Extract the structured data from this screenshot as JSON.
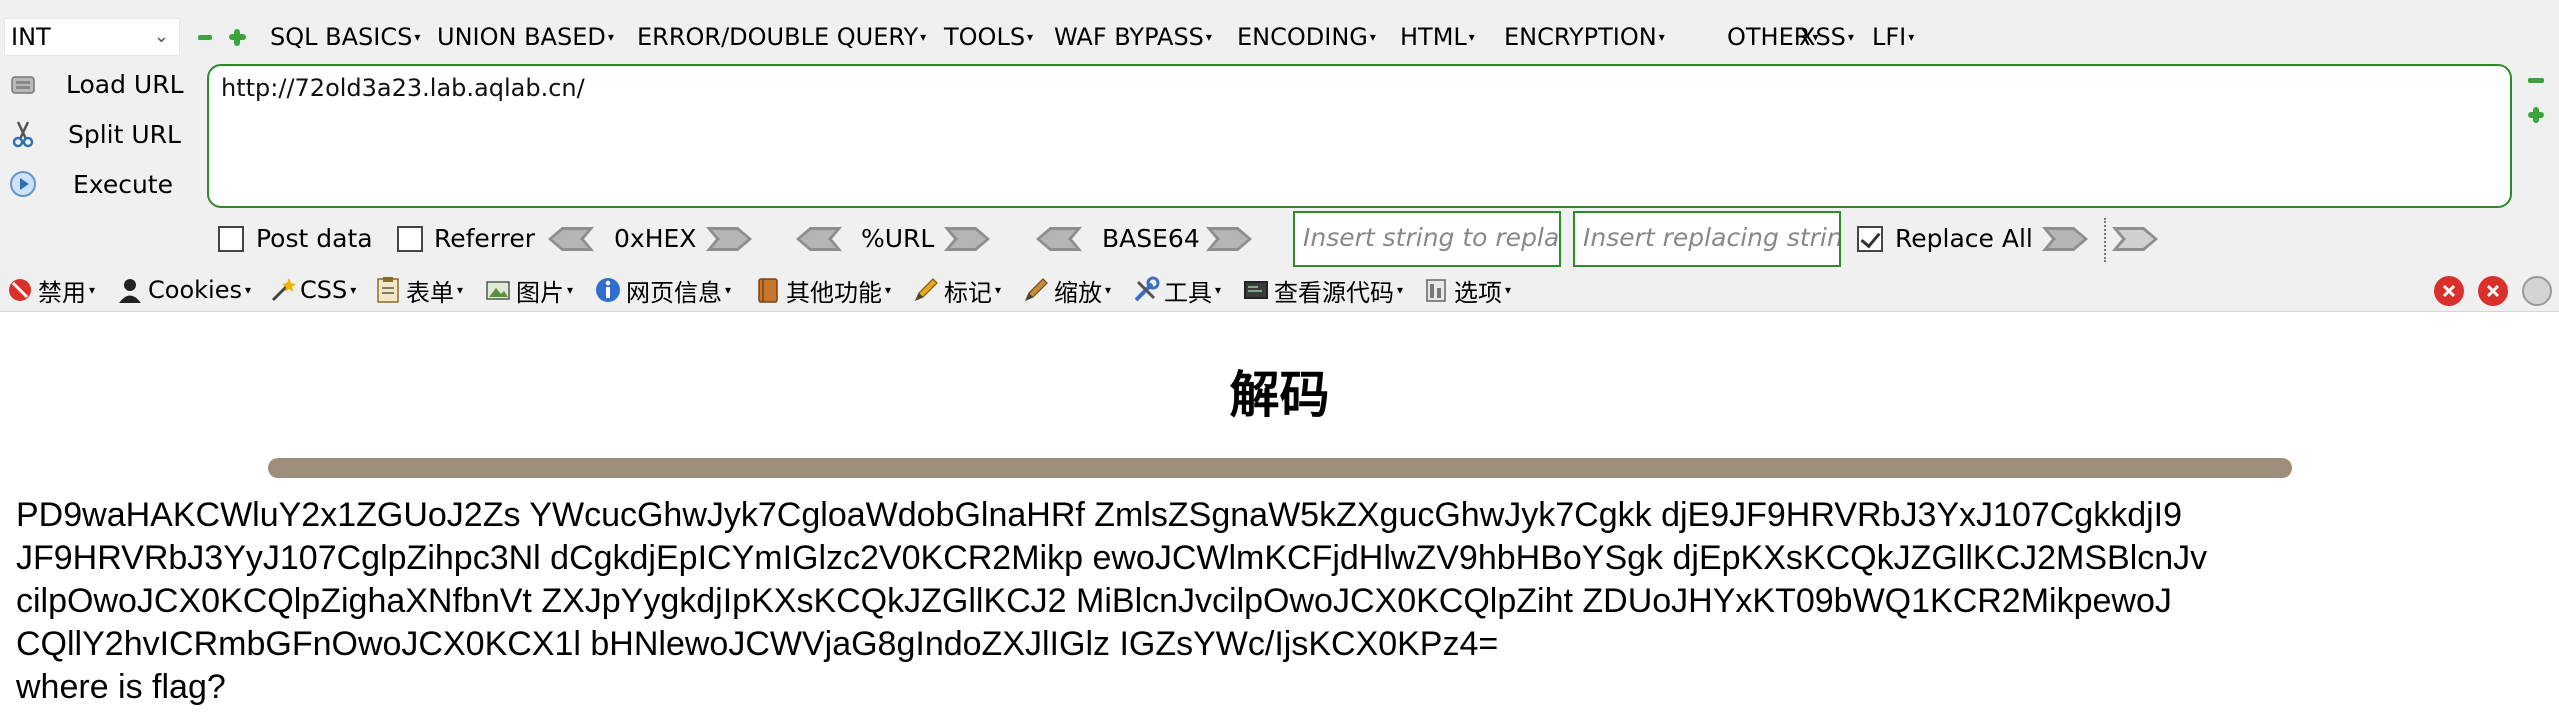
{
  "hackbar": {
    "select_value": "INT",
    "menu": [
      {
        "label": "SQL BASICS"
      },
      {
        "label": "UNION BASED"
      },
      {
        "label": "ERROR/DOUBLE QUERY"
      },
      {
        "label": "TOOLS"
      },
      {
        "label": "WAF BYPASS"
      },
      {
        "label": "ENCODING"
      },
      {
        "label": "HTML"
      },
      {
        "label": "ENCRYPTION"
      },
      {
        "label": "OTHER"
      },
      {
        "label": "XSS"
      },
      {
        "label": "LFI"
      }
    ],
    "load_url": "Load URL",
    "split_url": "Split URL",
    "execute": "Execute",
    "url_value": "http://72old3a23.lab.aqlab.cn/",
    "post_data": "Post data",
    "referrer": "Referrer",
    "hex": "0xHEX",
    "url_enc": "%URL",
    "base64": "BASE64",
    "replace_placeholder": "Insert string to replace",
    "replacing_placeholder": "Insert replacing string",
    "replace_all": "Replace All",
    "post_data_checked": false,
    "referrer_checked": false,
    "replace_all_checked": true
  },
  "toolbar": {
    "items": [
      {
        "label": "禁用",
        "icon": "disable-icon"
      },
      {
        "label": "Cookies",
        "icon": "cookie-icon"
      },
      {
        "label": "CSS",
        "icon": "css-wand-icon"
      },
      {
        "label": "表单",
        "icon": "form-icon"
      },
      {
        "label": "图片",
        "icon": "image-icon"
      },
      {
        "label": "网页信息",
        "icon": "info-icon"
      },
      {
        "label": "其他功能",
        "icon": "misc-icon"
      },
      {
        "label": "标记",
        "icon": "pencil-icon"
      },
      {
        "label": "缩放",
        "icon": "resize-icon"
      },
      {
        "label": "工具",
        "icon": "tools-icon"
      },
      {
        "label": "查看源代码",
        "icon": "source-icon"
      },
      {
        "label": "选项",
        "icon": "options-icon"
      }
    ]
  },
  "page": {
    "title": "解码",
    "lines": [
      "PD9waHAKCWluY2x1ZGUoJ2Zs YWcucGhwJyk7CgloaWdobGlnaHRf ZmlsZSgnaW5kZXgucGhwJyk7Cgkk djE9JF9HRVRbJ3YxJ107CgkkdjI9",
      "JF9HRVRbJ3YyJ107CglpZihpc3Nl dCgkdjEpICYmIGlzc2V0KCR2Mikp ewoJCWlmKCFjdHlwZV9hbHBoYSgk djEpKXsKCQkJZGllKCJ2MSBlcnJv",
      "cilpOwoJCX0KCQlpZighaXNfbnVt ZXJpYygkdjIpKXsKCQkJZGllKCJ2 MiBlcnJvcilpOwoJCX0KCQlpZiht ZDUoJHYxKT09bWQ1KCR2MikpewoJ",
      "CQllY2hvICRmbGFnOwoJCX0KCX1l bHNlewoJCWVjaG8gIndoZXJlIGlz IGZsYWc/IjsKCX0KPz4=",
      "where is flag?"
    ]
  },
  "colors": {
    "accent_green": "#2d8a2d",
    "divider": "#a08e7c",
    "close_red": "#d9302c"
  }
}
